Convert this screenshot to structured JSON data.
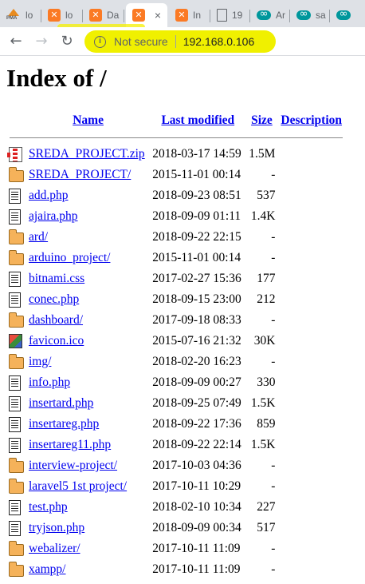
{
  "browser": {
    "tabs": [
      {
        "title": "lo",
        "icon": "phpmyadmin-icon",
        "active": false
      },
      {
        "title": "lo",
        "icon": "xampp-icon",
        "active": false
      },
      {
        "title": "Da",
        "icon": "xampp-icon",
        "active": false
      },
      {
        "title": "",
        "icon": "xampp-icon",
        "active": true,
        "close": "×"
      },
      {
        "title": "In",
        "icon": "xampp-icon",
        "active": false
      },
      {
        "title": "19",
        "icon": "page-icon",
        "active": false
      },
      {
        "title": "Ar",
        "icon": "arduino-icon",
        "active": false
      },
      {
        "title": "sa",
        "icon": "arduino-icon",
        "active": false
      },
      {
        "title": "",
        "icon": "arduino-icon",
        "active": false
      }
    ],
    "pma_icon_text": "PMA",
    "toolbar": {
      "back_icon": "←",
      "forward_icon": "→",
      "reload_icon": "↻",
      "info_icon": "i",
      "security_label": "Not secure",
      "url": "192.168.0.106"
    },
    "highlight_color": "#f0f000"
  },
  "page": {
    "title": "Index of /",
    "columns": {
      "name": "Name",
      "modified": "Last modified",
      "size": "Size",
      "description": "Description"
    },
    "rows": [
      {
        "icon": "compressed",
        "name": "SREDA_PROJECT.zip",
        "modified": "2018-03-17 14:59",
        "size": "1.5M",
        "description": ""
      },
      {
        "icon": "folder",
        "name": "SREDA_PROJECT/",
        "modified": "2015-11-01 00:14",
        "size": "-",
        "description": ""
      },
      {
        "icon": "text",
        "name": "add.php",
        "modified": "2018-09-23 08:51",
        "size": "537",
        "description": ""
      },
      {
        "icon": "text",
        "name": "ajaira.php",
        "modified": "2018-09-09 01:11",
        "size": "1.4K",
        "description": ""
      },
      {
        "icon": "folder",
        "name": "ard/",
        "modified": "2018-09-22 22:15",
        "size": "-",
        "description": ""
      },
      {
        "icon": "folder",
        "name": "arduino_project/",
        "modified": "2015-11-01 00:14",
        "size": "-",
        "description": ""
      },
      {
        "icon": "text",
        "name": "bitnami.css",
        "modified": "2017-02-27 15:36",
        "size": "177",
        "description": ""
      },
      {
        "icon": "text",
        "name": "conec.php",
        "modified": "2018-09-15 23:00",
        "size": "212",
        "description": ""
      },
      {
        "icon": "folder",
        "name": "dashboard/",
        "modified": "2017-09-18 08:33",
        "size": "-",
        "description": ""
      },
      {
        "icon": "image",
        "name": "favicon.ico",
        "modified": "2015-07-16 21:32",
        "size": "30K",
        "description": ""
      },
      {
        "icon": "folder",
        "name": "img/",
        "modified": "2018-02-20 16:23",
        "size": "-",
        "description": ""
      },
      {
        "icon": "text",
        "name": "info.php",
        "modified": "2018-09-09 00:27",
        "size": "330",
        "description": ""
      },
      {
        "icon": "text",
        "name": "insertard.php",
        "modified": "2018-09-25 07:49",
        "size": "1.5K",
        "description": ""
      },
      {
        "icon": "text",
        "name": "insertareg.php",
        "modified": "2018-09-22 17:36",
        "size": "859",
        "description": ""
      },
      {
        "icon": "text",
        "name": "insertareg11.php",
        "modified": "2018-09-22 22:14",
        "size": "1.5K",
        "description": ""
      },
      {
        "icon": "folder",
        "name": "interview-project/",
        "modified": "2017-10-03 04:36",
        "size": "-",
        "description": ""
      },
      {
        "icon": "folder",
        "name": "laravel5 1st project/",
        "modified": "2017-10-11 10:29",
        "size": "-",
        "description": ""
      },
      {
        "icon": "text",
        "name": "test.php",
        "modified": "2018-02-10 10:34",
        "size": "227",
        "description": ""
      },
      {
        "icon": "text",
        "name": "tryjson.php",
        "modified": "2018-09-09 00:34",
        "size": "517",
        "description": ""
      },
      {
        "icon": "folder",
        "name": "webalizer/",
        "modified": "2017-10-11 11:09",
        "size": "-",
        "description": ""
      },
      {
        "icon": "folder",
        "name": "xampp/",
        "modified": "2017-10-11 11:09",
        "size": "-",
        "description": ""
      }
    ]
  }
}
